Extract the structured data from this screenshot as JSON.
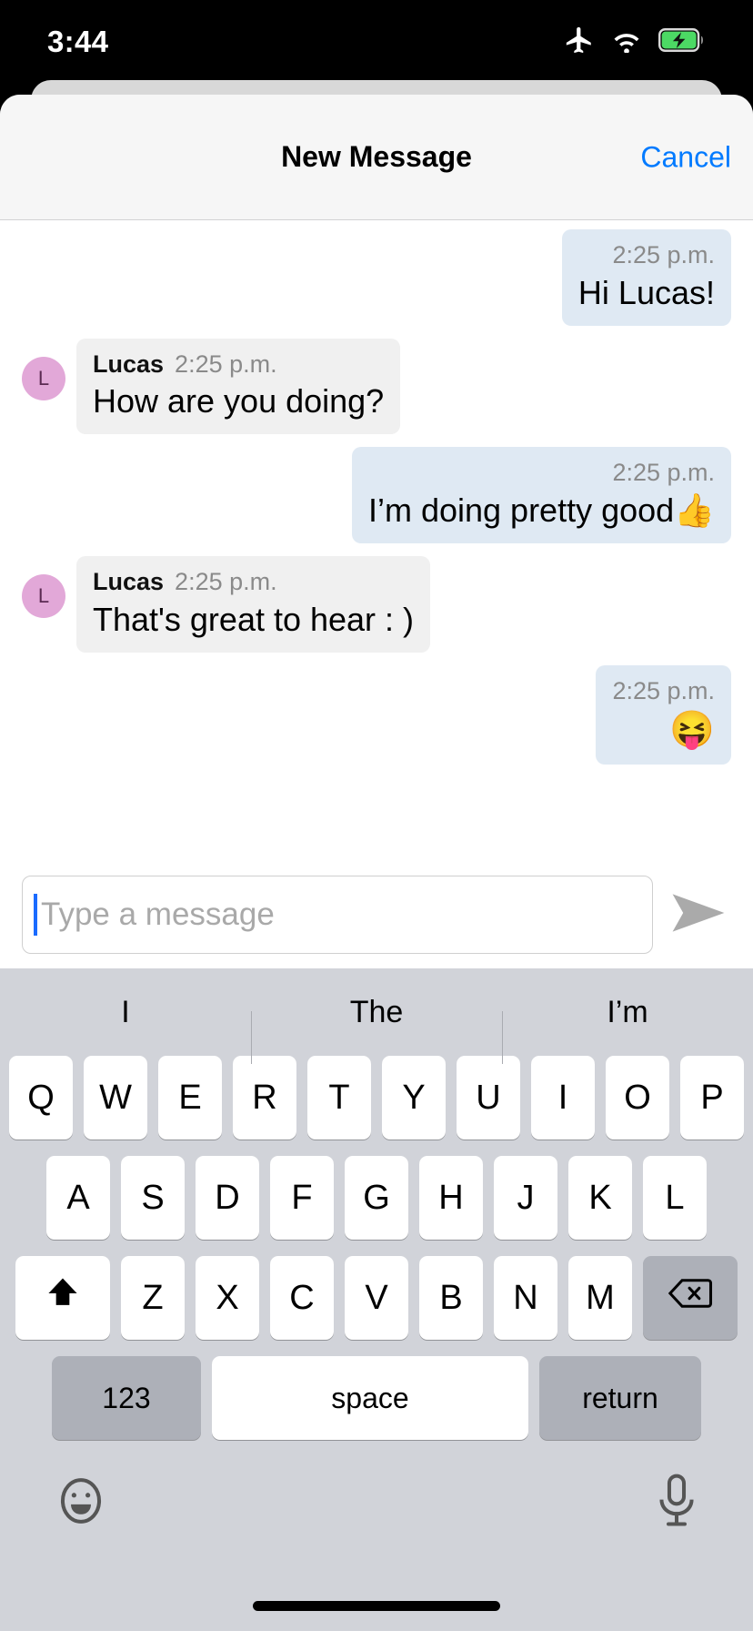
{
  "status_bar": {
    "time": "3:44",
    "icons": [
      "airplane-icon",
      "wifi-icon",
      "battery-charging-icon"
    ]
  },
  "sheet": {
    "title": "New Message",
    "cancel_label": "Cancel",
    "accent_color": "#007aff"
  },
  "conversation": {
    "messages": [
      {
        "direction": "outgoing",
        "sender": "",
        "time": "2:25 p.m.",
        "text": "Hi Lucas!"
      },
      {
        "direction": "incoming",
        "sender": "Lucas",
        "avatar_initial": "L",
        "time": "2:25 p.m.",
        "text": "How are you doing?"
      },
      {
        "direction": "outgoing",
        "sender": "",
        "time": "2:25 p.m.",
        "text": "I’m doing pretty good👍"
      },
      {
        "direction": "incoming",
        "sender": "Lucas",
        "avatar_initial": "L",
        "time": "2:25 p.m.",
        "text": "That's great to hear : )"
      },
      {
        "direction": "outgoing",
        "sender": "",
        "time": "2:25 p.m.",
        "text": "😝"
      }
    ],
    "outgoing_bubble_color": "#dfe9f3",
    "incoming_bubble_color": "#f0f0f0",
    "avatar_color": "#e2a8d8"
  },
  "composer": {
    "value": "",
    "placeholder": "Type a message",
    "send_icon": "send-arrow-icon"
  },
  "keyboard": {
    "predictions": [
      "I",
      "The",
      "I’m"
    ],
    "row1": [
      "Q",
      "W",
      "E",
      "R",
      "T",
      "Y",
      "U",
      "I",
      "O",
      "P"
    ],
    "row2": [
      "A",
      "S",
      "D",
      "F",
      "G",
      "H",
      "J",
      "K",
      "L"
    ],
    "row3_letters": [
      "Z",
      "X",
      "C",
      "V",
      "B",
      "N",
      "M"
    ],
    "shift_label": "shift-icon",
    "backspace_label": "backspace-icon",
    "numbers_label": "123",
    "space_label": "space",
    "return_label": "return",
    "emoji_label": "emoji-icon",
    "mic_label": "microphone-icon"
  }
}
